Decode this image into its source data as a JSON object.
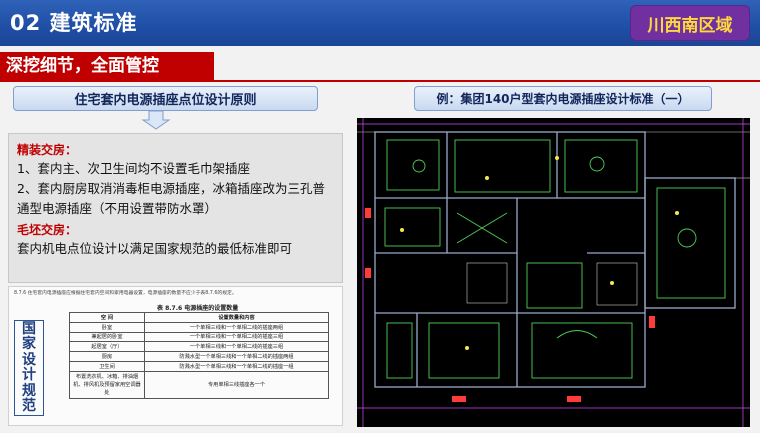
{
  "header": {
    "title": "02 建筑标准",
    "region": "川西南区域"
  },
  "subtitle": "深挖细节，全面管控",
  "principle": {
    "title": "住宅套内电源插座点位设计原则"
  },
  "content": {
    "heading1": "精装交房：",
    "line1": "1、套内主、次卫生间均不设置毛巾架插座",
    "line2": "2、套内厨房取消消毒柜电源插座，冰箱插座改为三孔普",
    "line3": "通型电源插座（不用设置带防水罩）",
    "heading2": "毛坯交房：",
    "line4": "套内机电点位设计以满足国家规范的最低标准即可"
  },
  "spec": {
    "vertical_label": [
      "国",
      "家",
      "设",
      "计",
      "规",
      "范"
    ],
    "caption": "8.7.6 住宅套内电源插座应根据住宅套内空间和家用电器设置，电源插座的数量不应少于表8.7.6的规定。",
    "table_title": "表 8.7.6  电源插座的设置数量",
    "columns": [
      "空    间",
      "设置数量和内容"
    ],
    "rows": [
      [
        "卧室",
        "一个单相三线和一个单相二线的插座两组"
      ],
      [
        "兼起居的卧室",
        "一个单相三线和一个单相二线的插座三组"
      ],
      [
        "起居室（厅）",
        "一个单相三线和一个单相二线的插座三组"
      ],
      [
        "厨房",
        "防溅水型一个单相三线和一个单相二线的插座两组"
      ],
      [
        "卫生间",
        "防溅水型一个单相三线和一个单相二线的插座一组"
      ],
      [
        "布置洗衣机、冰箱、排油烟机、排风机及预留家用空调器处",
        "专用单相三线插座各一个"
      ]
    ]
  },
  "example": {
    "title": "例：集团140户型套内电源插座设计标准（一）"
  },
  "colors": {
    "header_blue": "#2458ad",
    "badge_purple": "#7030a0",
    "badge_text": "#ffd83b",
    "accent_red": "#c00000",
    "cad_bg": "#000000"
  }
}
